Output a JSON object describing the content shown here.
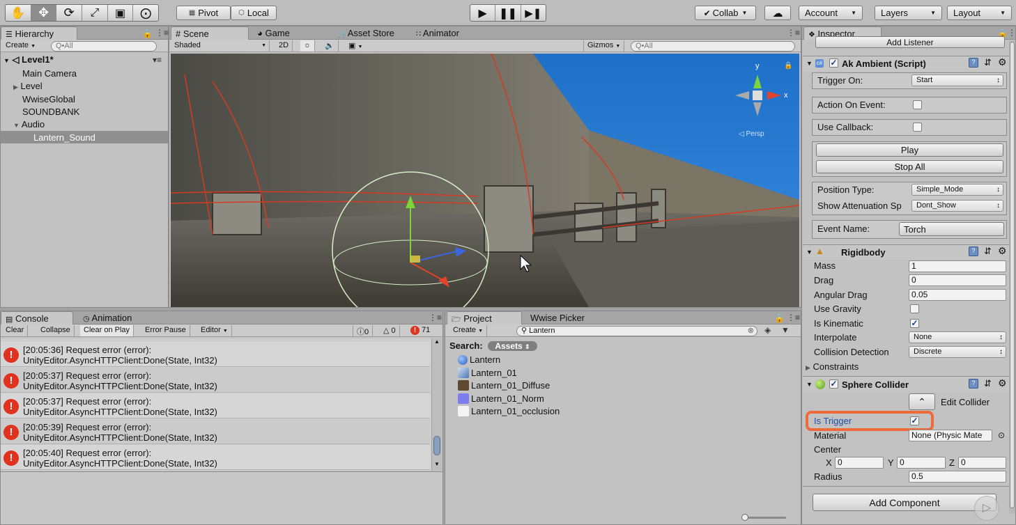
{
  "toolbar": {
    "tools": [
      "hand-icon",
      "move-icon",
      "rotate-icon",
      "scale-icon",
      "rect-icon",
      "transform-icon"
    ],
    "pivot": "Pivot",
    "local": "Local",
    "collab": "Collab",
    "account": "Account",
    "layers": "Layers",
    "layout": "Layout"
  },
  "hierarchy": {
    "tab": "Hierarchy",
    "create": "Create",
    "search_placeholder": "Q•All",
    "scene": "Level1*",
    "items": [
      "Main Camera",
      "Level",
      "WwiseGlobal",
      "SOUNDBANK",
      "Audio",
      "Lantern_Sound"
    ]
  },
  "scene": {
    "tabs": [
      "Scene",
      "Game",
      "Asset Store",
      "Animator"
    ],
    "shading": "Shaded",
    "mode_2d": "2D",
    "gizmos": "Gizmos",
    "search_placeholder": "Q•All",
    "gizmo_y": "y",
    "gizmo_x": "x",
    "persp": "◁ Persp"
  },
  "console": {
    "tabs": [
      "Console",
      "Animation"
    ],
    "buttons": [
      "Clear",
      "Collapse",
      "Clear on Play",
      "Error Pause",
      "Editor"
    ],
    "counts": {
      "log": "0",
      "warn": "0",
      "error": "71"
    },
    "rows": [
      {
        "line1": "[20:05:36] Request error (error):",
        "line2": "UnityEditor.AsyncHTTPClient:Done(State, Int32)"
      },
      {
        "line1": "[20:05:37] Request error (error):",
        "line2": "UnityEditor.AsyncHTTPClient:Done(State, Int32)"
      },
      {
        "line1": "[20:05:37] Request error (error):",
        "line2": "UnityEditor.AsyncHTTPClient:Done(State, Int32)"
      },
      {
        "line1": "[20:05:39] Request error (error):",
        "line2": "UnityEditor.AsyncHTTPClient:Done(State, Int32)"
      },
      {
        "line1": "[20:05:40] Request error (error):",
        "line2": "UnityEditor.AsyncHTTPClient:Done(State, Int32)"
      }
    ]
  },
  "project": {
    "tabs": [
      "Project",
      "Wwise Picker"
    ],
    "create": "Create",
    "search_value": "Lantern",
    "search_label": "Search:",
    "scope": "Assets",
    "assets": [
      "Lantern",
      "Lantern_01",
      "Lantern_01_Diffuse",
      "Lantern_01_Norm",
      "Lantern_01_occlusion"
    ]
  },
  "inspector": {
    "tab": "Inspector",
    "add_listener": "Add Listener",
    "ak_ambient": {
      "title": "Ak Ambient (Script)",
      "trigger_on_label": "Trigger On:",
      "trigger_on_value": "Start",
      "action_on_event_label": "Action On Event:",
      "use_callback_label": "Use Callback:",
      "play": "Play",
      "stop_all": "Stop All",
      "position_type_label": "Position Type:",
      "position_type_value": "Simple_Mode",
      "show_attenuation_label": "Show Attenuation Sp",
      "show_attenuation_value": "Dont_Show",
      "event_name_label": "Event Name:",
      "event_name_value": "Torch"
    },
    "rigidbody": {
      "title": "Rigidbody",
      "mass_label": "Mass",
      "mass": "1",
      "drag_label": "Drag",
      "drag": "0",
      "angular_drag_label": "Angular Drag",
      "angular_drag": "0.05",
      "use_gravity_label": "Use Gravity",
      "is_kinematic_label": "Is Kinematic",
      "interpolate_label": "Interpolate",
      "interpolate": "None",
      "collision_label": "Collision Detection",
      "collision": "Discrete",
      "constraints_label": "Constraints"
    },
    "sphere_collider": {
      "title": "Sphere Collider",
      "edit_collider": "Edit Collider",
      "is_trigger_label": "Is Trigger",
      "material_label": "Material",
      "material": "None (Physic Mate",
      "center_label": "Center",
      "x_label": "X",
      "x": "0",
      "y_label": "Y",
      "y": "0",
      "z_label": "Z",
      "z": "0",
      "radius_label": "Radius",
      "radius": "0.5"
    },
    "add_component": "Add Component"
  },
  "colors": {
    "highlight": "#ee6a3a",
    "selection": "#8f8f8f",
    "error": "#e0321e"
  }
}
